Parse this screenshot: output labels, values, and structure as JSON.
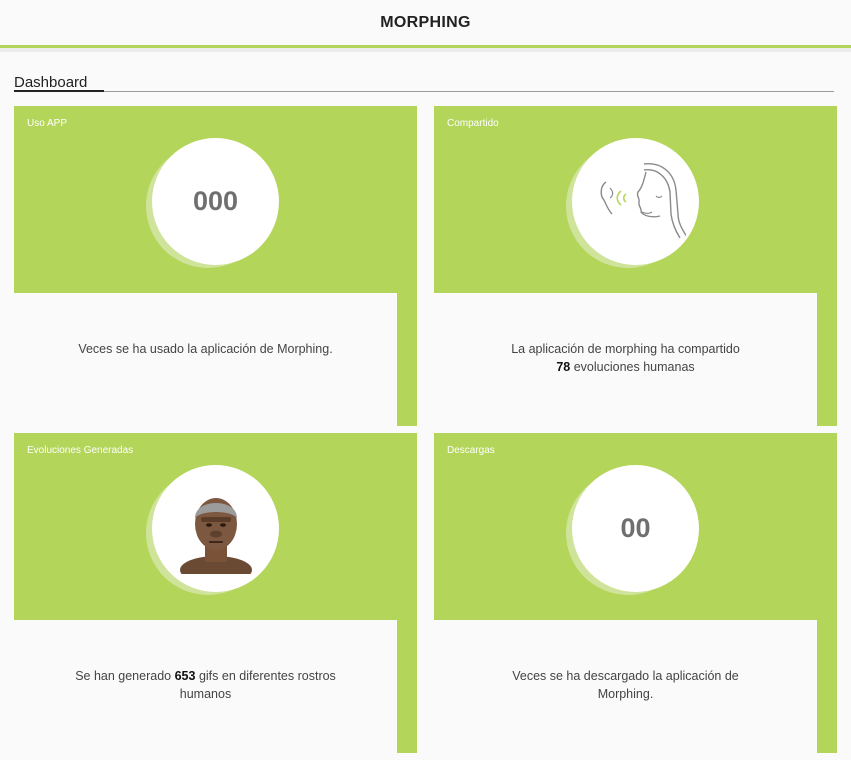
{
  "header": {
    "title": "MORPHING"
  },
  "section": {
    "title": "Dashboard"
  },
  "cards": [
    {
      "label": "Uso APP",
      "value": "000",
      "desc": "Veces se ha usado la aplicación de Morphing."
    },
    {
      "label": "Compartido",
      "icon": "face-profile-icon",
      "desc_pre": "La aplicación de morphing ha compartido",
      "desc_bold": "78",
      "desc_post": "evoluciones humanas"
    },
    {
      "label": "Evoluciones Generadas",
      "icon": "hominid-face-icon",
      "desc_pre": "Se han generado",
      "desc_bold": "653",
      "desc_post": "gifs en diferentes rostros humanos"
    },
    {
      "label": "Descargas",
      "value": "00",
      "desc": "Veces se ha descargado la aplicación de Morphing."
    }
  ],
  "colors": {
    "accent": "#b3d55a",
    "background": "#fafafa"
  }
}
